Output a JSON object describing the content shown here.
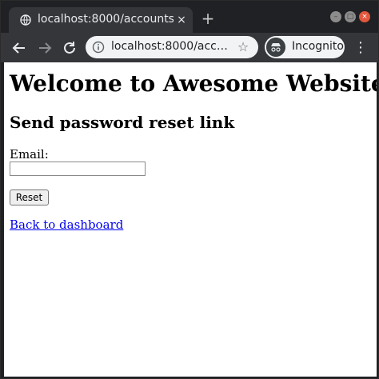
{
  "browser": {
    "tab_title": "localhost:8000/accounts/",
    "tab_close": "×",
    "new_tab": "+",
    "url": "localhost:8000/accou...",
    "incognito_label": "Incognito",
    "menu": "⋮",
    "star": "☆"
  },
  "page": {
    "heading": "Welcome to Awesome Website",
    "subheading": "Send password reset link",
    "email_label": "Email:",
    "email_value": "",
    "reset_button": "Reset",
    "back_link": "Back to dashboard"
  }
}
